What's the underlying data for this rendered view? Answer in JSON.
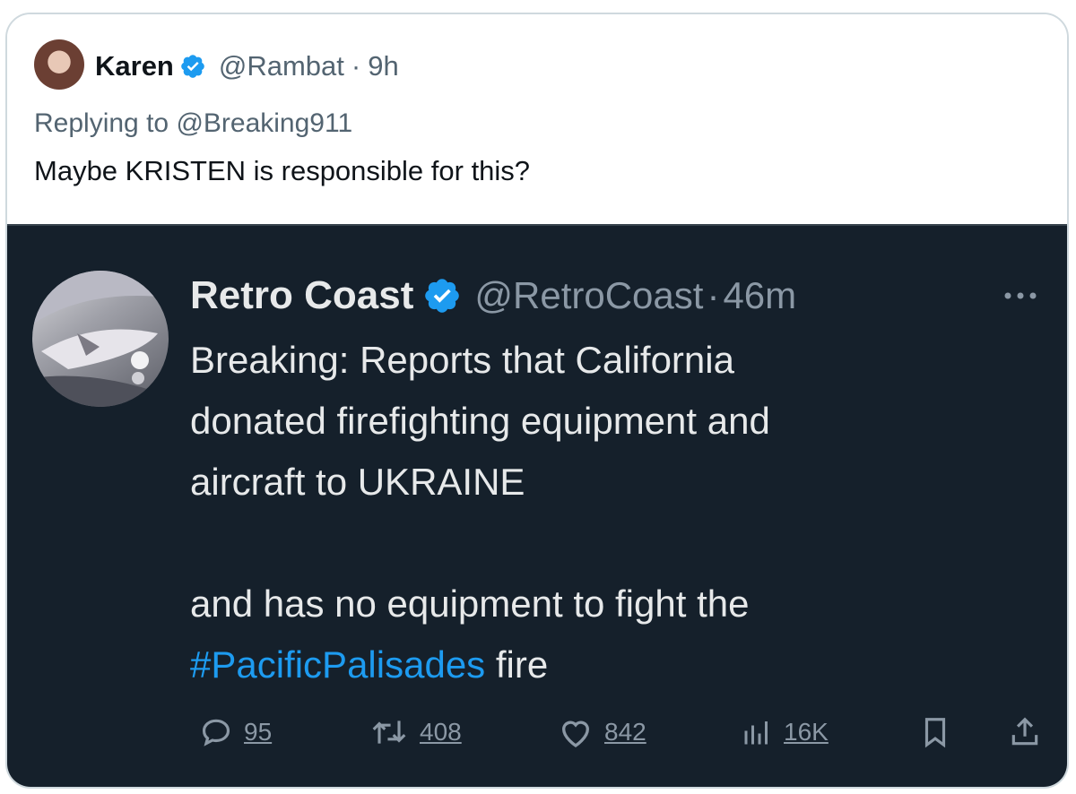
{
  "reply_tweet": {
    "author_name": "Karen",
    "author_handle": "@Rambat",
    "separator": "·",
    "time": "9h",
    "replying_prefix": "Replying to",
    "replying_to": "@Breaking911",
    "text": "Maybe KRISTEN is responsible for this?"
  },
  "quoted_tweet": {
    "author_name": "Retro Coast",
    "author_handle": "@RetroCoast",
    "separator": "·",
    "time": "46m",
    "text_line1": "Breaking: Reports that California",
    "text_line2": "donated firefighting equipment and",
    "text_line3": "aircraft to UKRAINE",
    "text_line4": "and has no equipment to fight the",
    "hashtag": "#PacificPalisades",
    "text_line5_rest": " fire",
    "metrics": {
      "replies": "95",
      "reposts": "408",
      "likes": "842",
      "views": "16K"
    }
  },
  "colors": {
    "verified": "#1d9bf0",
    "link": "#1d9bf0",
    "dark_bg": "#15202b",
    "muted": "#536471"
  },
  "icons": [
    "verified-badge-icon",
    "more-icon",
    "reply-icon",
    "repost-icon",
    "like-icon",
    "views-icon",
    "bookmark-icon",
    "share-icon"
  ]
}
